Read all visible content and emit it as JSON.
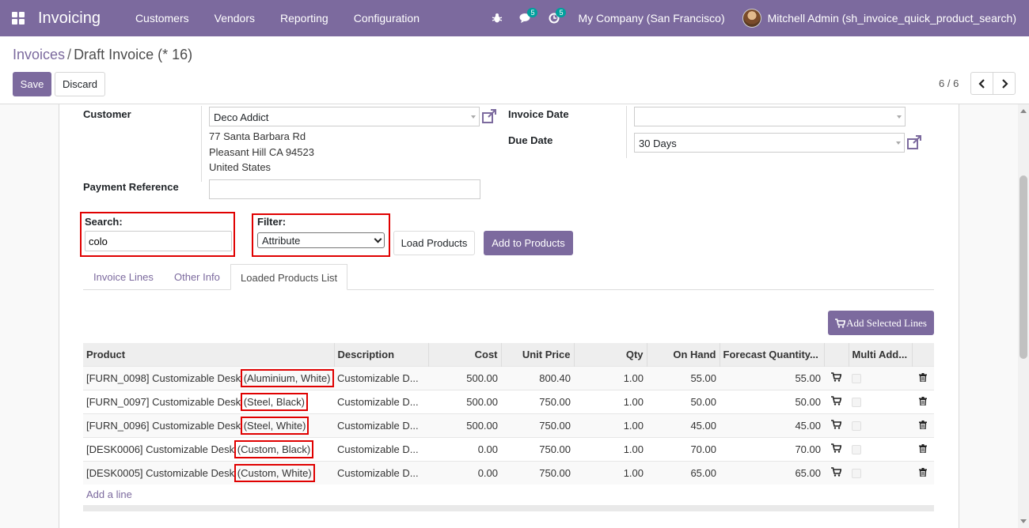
{
  "nav": {
    "app_title": "Invoicing",
    "menu": [
      "Customers",
      "Vendors",
      "Reporting",
      "Configuration"
    ],
    "messages_badge": "5",
    "activities_badge": "5",
    "company": "My Company (San Francisco)",
    "user": "Mitchell Admin (sh_invoice_quick_product_search)"
  },
  "breadcrumb": {
    "parent": "Invoices",
    "separator": "/",
    "current": "Draft Invoice (* 16)"
  },
  "toolbar": {
    "save_label": "Save",
    "discard_label": "Discard",
    "pager": "6 / 6"
  },
  "form": {
    "customer_label": "Customer",
    "customer_value": "Deco Addict",
    "address_line1": "77 Santa Barbara Rd",
    "address_line2": "Pleasant Hill CA 94523",
    "address_line3": "United States",
    "payment_ref_label": "Payment Reference",
    "payment_ref_value": "",
    "invoice_date_label": "Invoice Date",
    "invoice_date_value": "",
    "due_date_label": "Due Date",
    "due_date_value": "30 Days"
  },
  "quick_search": {
    "search_label": "Search:",
    "search_value": "colo",
    "filter_label": "Filter:",
    "filter_value": "Attribute",
    "load_button": "Load Products",
    "add_button": "Add to Products"
  },
  "tabs": [
    "Invoice Lines",
    "Other Info",
    "Loaded Products List"
  ],
  "active_tab": "Loaded Products List",
  "loaded_products": {
    "add_selected_label": "Add Selected Lines",
    "columns": [
      "Product",
      "Description",
      "Cost",
      "Unit Price",
      "Qty",
      "On Hand",
      "Forecast Quantity...",
      "",
      "Multi Add...",
      ""
    ],
    "rows": [
      {
        "product": "[FURN_0098] Customizable Desk",
        "variant": "(Aluminium, White)",
        "description": "Customizable D...",
        "cost": "500.00",
        "unit_price": "800.40",
        "qty": "1.00",
        "on_hand": "55.00",
        "forecast": "55.00"
      },
      {
        "product": "[FURN_0097] Customizable Desk",
        "variant": "(Steel, Black)",
        "description": "Customizable D...",
        "cost": "500.00",
        "unit_price": "750.00",
        "qty": "1.00",
        "on_hand": "50.00",
        "forecast": "50.00"
      },
      {
        "product": "[FURN_0096] Customizable Desk",
        "variant": "(Steel, White)",
        "description": "Customizable D...",
        "cost": "500.00",
        "unit_price": "750.00",
        "qty": "1.00",
        "on_hand": "45.00",
        "forecast": "45.00"
      },
      {
        "product": "[DESK0006] Customizable Desk",
        "variant": "(Custom, Black)",
        "description": "Customizable D...",
        "cost": "0.00",
        "unit_price": "750.00",
        "qty": "1.00",
        "on_hand": "70.00",
        "forecast": "70.00"
      },
      {
        "product": "[DESK0005] Customizable Desk",
        "variant": "(Custom, White)",
        "description": "Customizable D...",
        "cost": "0.00",
        "unit_price": "750.00",
        "qty": "1.00",
        "on_hand": "65.00",
        "forecast": "65.00"
      }
    ],
    "add_line_label": "Add a line"
  },
  "colors": {
    "brand": "#7c6a9e",
    "badge": "#00a09d",
    "highlight": "#e00000"
  }
}
